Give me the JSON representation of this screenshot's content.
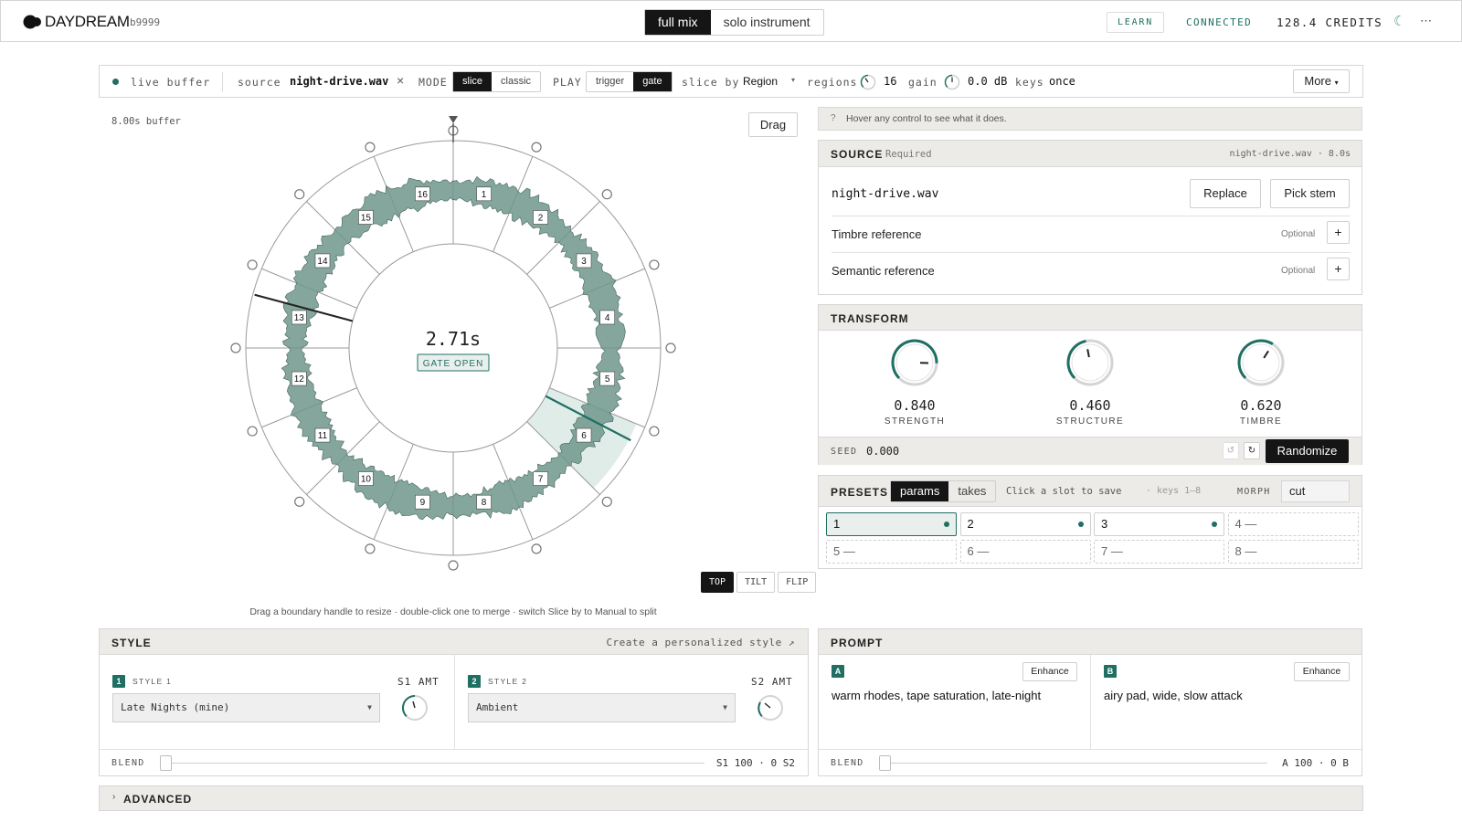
{
  "header": {
    "brand": "DAYDREAM",
    "build": "b9999",
    "mode_tabs": [
      "full mix",
      "solo instrument"
    ],
    "learn_label": "LEARN",
    "status": "CONNECTED",
    "credits": "128.4 CREDITS"
  },
  "toolbar": {
    "live_buffer": "live buffer",
    "source_label": "source",
    "source_file": "night-drive.wav",
    "close_glyph": "×",
    "mode_label": "MODE",
    "mode_options": [
      "slice",
      "classic"
    ],
    "play_label": "PLAY",
    "play_options": [
      "trigger",
      "gate"
    ],
    "slice_by_label": "slice by",
    "slice_by_value": "Region",
    "regions_label": "regions",
    "regions_value": "16",
    "gain_label": "gain",
    "gain_value": "0.0 dB",
    "keys_label": "keys",
    "keys_value": "once",
    "more_label": "More"
  },
  "wheel": {
    "buffer_label": "8.00s buffer",
    "drag_label": "Drag",
    "center_time": "2.71s",
    "center_status": "GATE OPEN",
    "regions": [
      "1",
      "2",
      "3",
      "4",
      "5",
      "6",
      "7",
      "8",
      "9",
      "10",
      "11",
      "12",
      "13",
      "14",
      "15",
      "16"
    ],
    "active_region": "6",
    "view_options": [
      "TOP",
      "TILT",
      "FLIP"
    ],
    "instructions": "Drag a boundary handle to resize · double-click one to merge · switch Slice by to Manual to split"
  },
  "hint": {
    "icon": "?",
    "text": "Hover any control to see what it does."
  },
  "source": {
    "title": "SOURCE",
    "required": "Required",
    "meta": "night-drive.wav · 8.0s",
    "file": "night-drive.wav",
    "replace_label": "Replace",
    "pick_stem_label": "Pick stem",
    "timbre_label": "Timbre reference",
    "semantic_label": "Semantic reference",
    "optional_label": "Optional",
    "add_glyph": "+"
  },
  "transform": {
    "title": "TRANSFORM",
    "knobs": [
      {
        "label": "STRENGTH",
        "value": "0.840",
        "level": 0.84
      },
      {
        "label": "STRUCTURE",
        "value": "0.460",
        "level": 0.46
      },
      {
        "label": "TIMBRE",
        "value": "0.620",
        "level": 0.62
      }
    ],
    "seed_label": "SEED",
    "seed_value": "0.000",
    "randomize_label": "Randomize"
  },
  "presets": {
    "title": "PRESETS",
    "tabs": [
      "params",
      "takes"
    ],
    "hint": "Click a slot to save",
    "keys_hint": "· keys 1–8",
    "morph_label": "MORPH",
    "morph_value": "cut",
    "slots": [
      {
        "label": "1",
        "filled": true
      },
      {
        "label": "2",
        "filled": true
      },
      {
        "label": "3",
        "filled": true
      },
      {
        "label": "4 —",
        "filled": false
      },
      {
        "label": "5 —",
        "filled": false
      },
      {
        "label": "6 —",
        "filled": false
      },
      {
        "label": "7 —",
        "filled": false
      },
      {
        "label": "8 —",
        "filled": false
      }
    ]
  },
  "style": {
    "title": "STYLE",
    "personalize_link": "Create a personalized style ↗",
    "style1_badge": "1",
    "style1_label": "STYLE 1",
    "style1_value": "Late Nights (mine)",
    "s1_amt_label": "S1 AMT",
    "style2_badge": "2",
    "style2_label": "STYLE 2",
    "style2_value": "Ambient",
    "s2_amt_label": "S2 AMT",
    "blend_label": "BLEND",
    "blend_value": "S1 100 · 0 S2",
    "blend_level": 0
  },
  "prompt": {
    "title": "PROMPT",
    "a_badge": "A",
    "a_text": "warm rhodes, tape saturation, late-night",
    "b_badge": "B",
    "b_text": "airy pad, wide, slow attack",
    "enhance_label": "Enhance",
    "blend_label": "BLEND",
    "blend_value": "A 100 · 0 B",
    "blend_level": 0
  },
  "advanced": {
    "label": "ADVANCED",
    "chevron": "›"
  },
  "colors": {
    "accent": "#1f6f63",
    "header_bg": "#ecebe8",
    "dark": "#151515",
    "waveform": "#6f978c"
  }
}
